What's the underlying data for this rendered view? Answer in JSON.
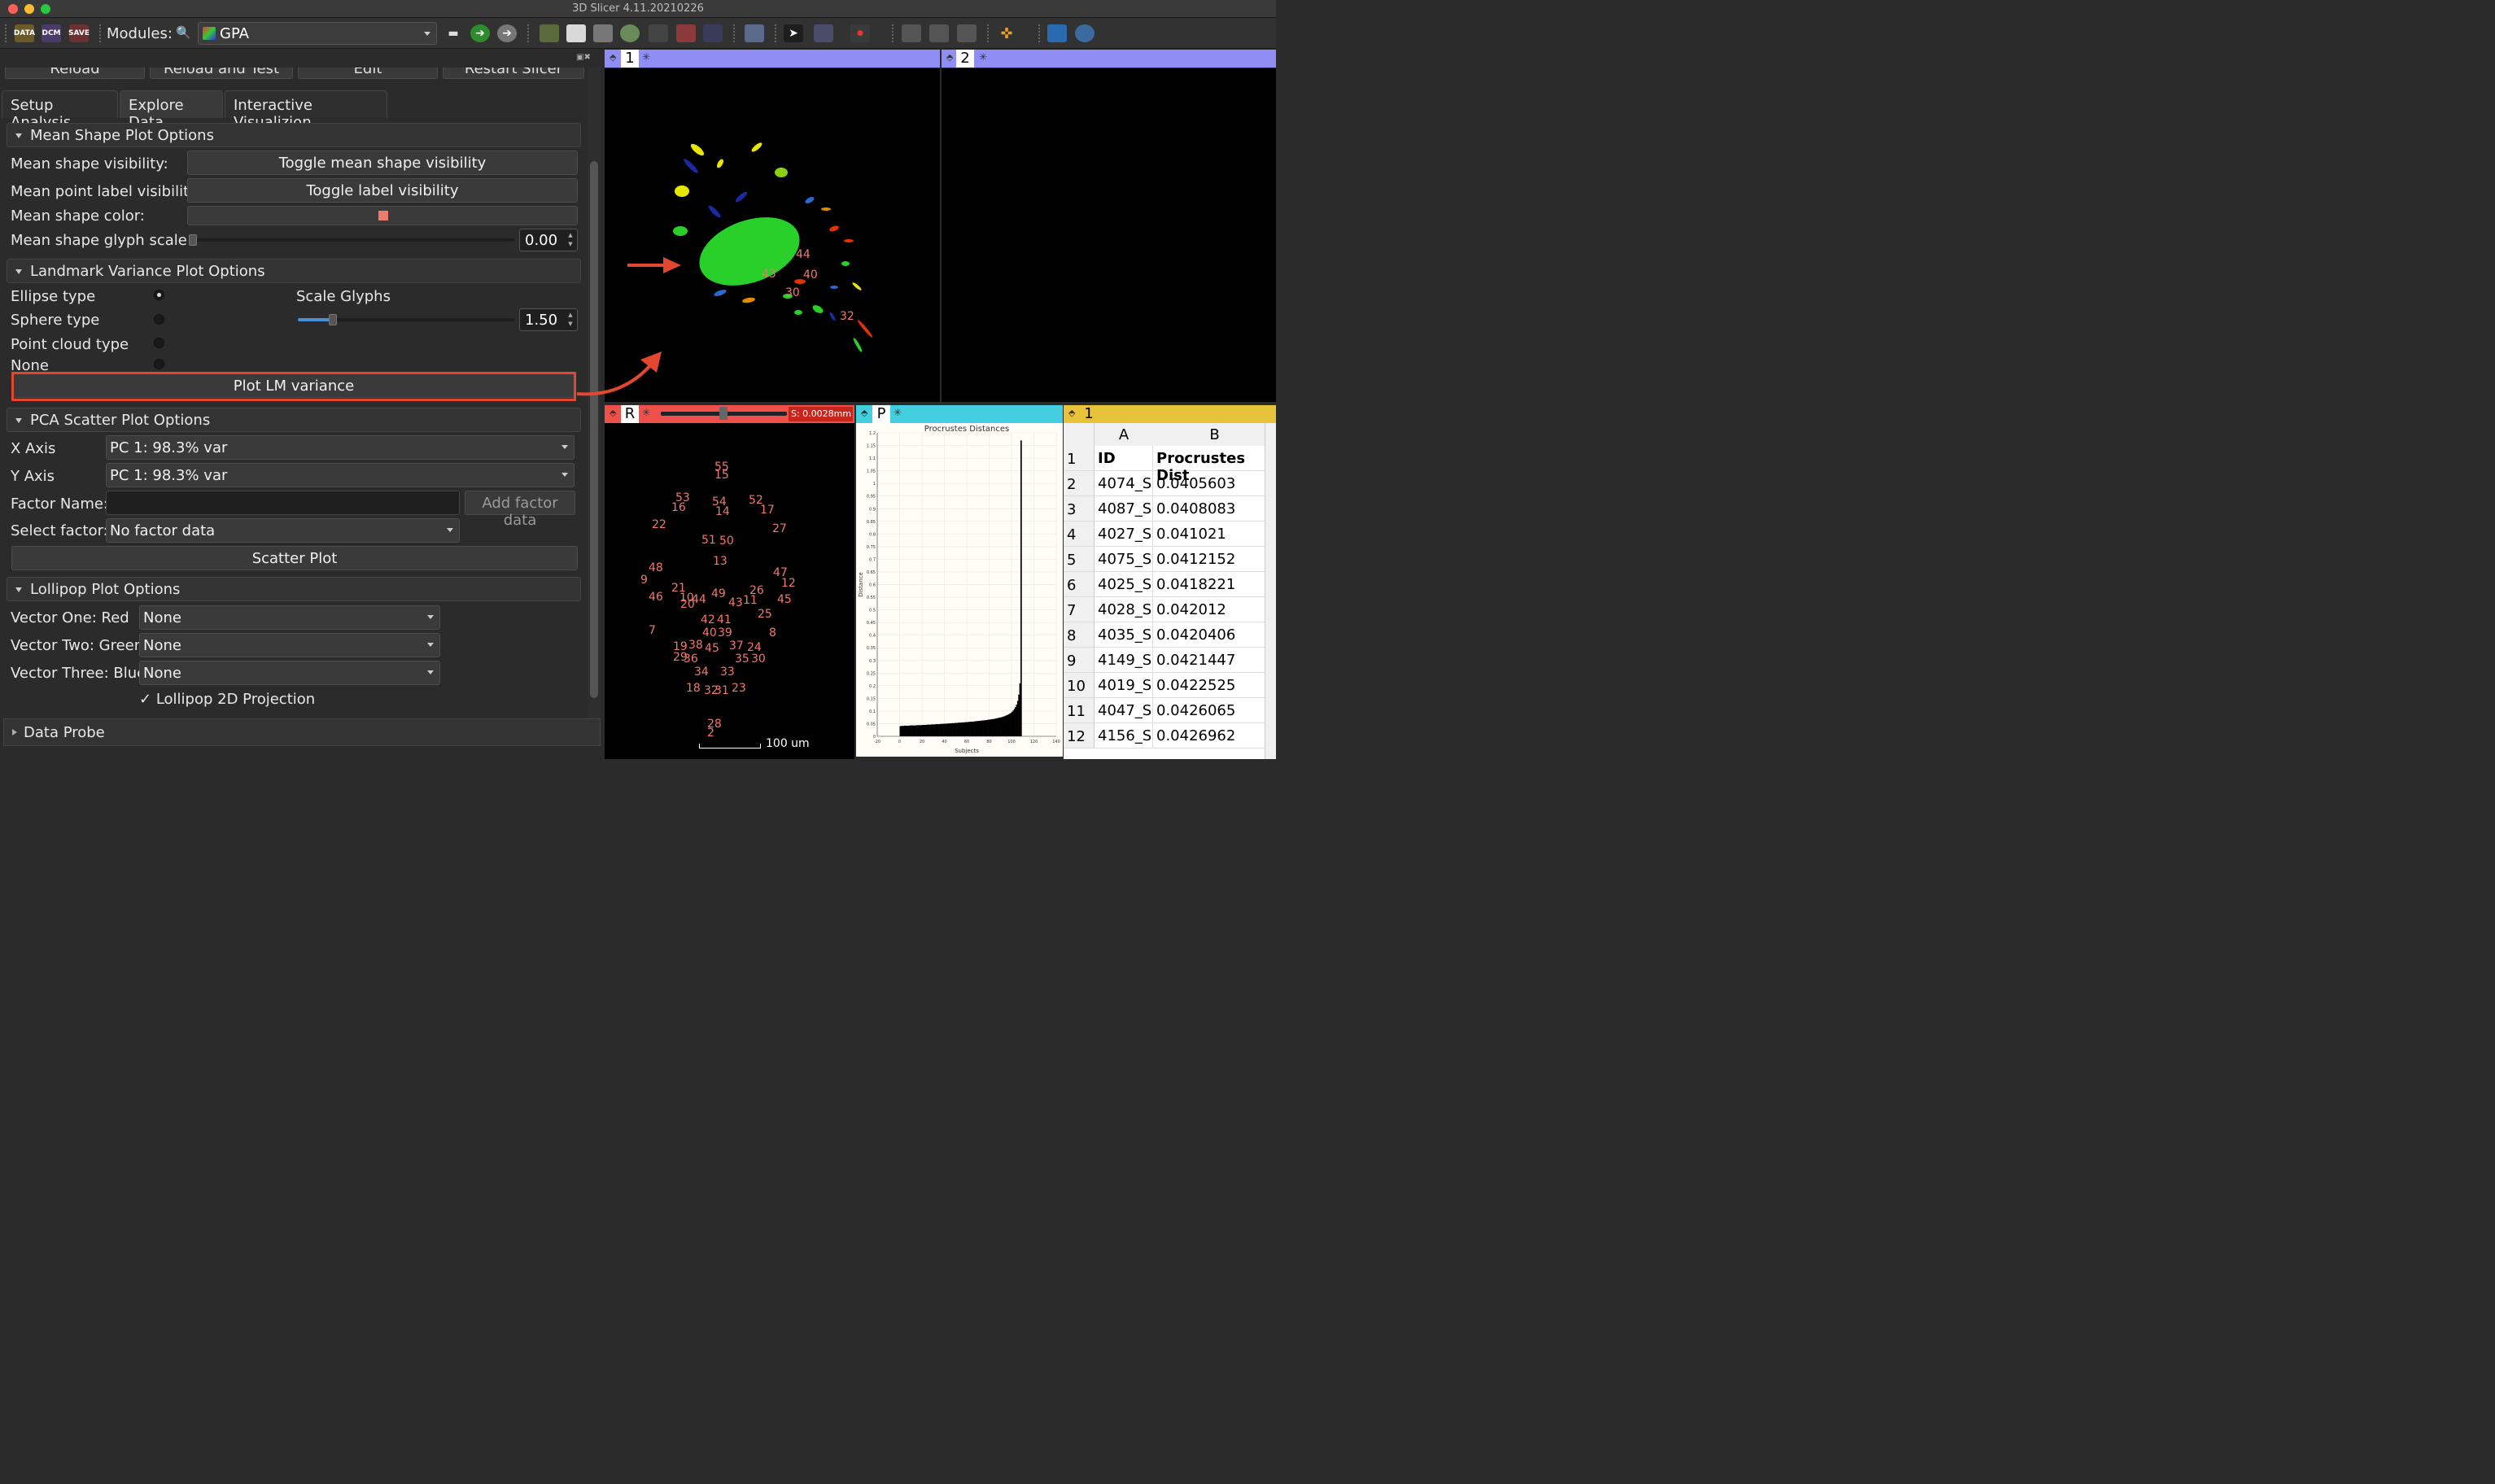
{
  "window": {
    "title": "3D Slicer 4.11.20210226"
  },
  "toolbar": {
    "data_label": "DATA",
    "dcm_label": "DCM",
    "save_label": "SAVE",
    "modules_label": "Modules:",
    "module_value": "GPA"
  },
  "module": {
    "top_buttons": [
      "Reload",
      "Reload and Test",
      "Edit",
      "Restart Slicer"
    ],
    "tabs": [
      "Setup Analysis",
      "Explore Data",
      "Interactive Visualizion"
    ],
    "mean_shape": {
      "header": "Mean Shape Plot Options",
      "visibility_label": "Mean shape visibility:",
      "visibility_button": "Toggle mean shape visibility",
      "label_label": "Mean point label visibility:",
      "label_button": "Toggle label visibility",
      "color_label": "Mean shape color:",
      "color": "#ec7b70",
      "scale_label": "Mean shape glyph scale",
      "scale_value": "0.00"
    },
    "landmark": {
      "header": "Landmark Variance Plot Options",
      "ellipse": "Ellipse type",
      "sphere": "Sphere type",
      "pointcloud": "Point cloud type",
      "none": "None",
      "scale_label": "Scale Glyphs",
      "scale_value": "1.50",
      "plot_button": "Plot LM variance"
    },
    "pca": {
      "header": "PCA Scatter Plot Options",
      "x_label": "X Axis",
      "x_value": "PC 1: 98.3% var",
      "y_label": "Y Axis",
      "y_value": "PC 1: 98.3% var",
      "factor_label": "Factor Name:",
      "add_factor": "Add factor data",
      "select_label": "Select factor:",
      "select_value": "No factor data",
      "scatter_button": "Scatter Plot"
    },
    "lollipop": {
      "header": "Lollipop Plot Options",
      "v1_label": "Vector One: Red",
      "v1": "None",
      "v2_label": "Vector Two: Green",
      "v2": "None",
      "v3_label": "Vector Three: Blue",
      "v3": "None",
      "proj_label": "Lollipop 2D Projection",
      "proj_checked": true
    },
    "dataprobe": "Data Probe"
  },
  "views": {
    "v1": {
      "label": "1",
      "annotations": [
        "44",
        "40",
        "43",
        "30",
        "32"
      ]
    },
    "v2": {
      "label": "2"
    },
    "red": {
      "label": "R",
      "offset": "S: 0.0028mm",
      "scalebar": "100 um",
      "landmarks": [
        "55",
        "15",
        "53",
        "16",
        "54",
        "14",
        "52",
        "17",
        "22",
        "27",
        "51",
        "50",
        "13",
        "48",
        "9",
        "47",
        "12",
        "21",
        "10",
        "20",
        "44",
        "49",
        "26",
        "11",
        "43",
        "45",
        "46",
        "42",
        "41",
        "25",
        "7",
        "40",
        "39",
        "8",
        "19",
        "38",
        "4",
        "5",
        "37",
        "24",
        "29",
        "36",
        "35",
        "30",
        "34",
        "33",
        "18",
        "32",
        "31",
        "23",
        "28",
        "2"
      ]
    },
    "plot": {
      "label": "P"
    },
    "table": {
      "label": "1",
      "col_a": "A",
      "col_b": "B",
      "rows": [
        [
          "1",
          "ID",
          "Procrustes Dist"
        ],
        [
          "2",
          "4074_S",
          "0.0405603"
        ],
        [
          "3",
          "4087_S",
          "0.0408083"
        ],
        [
          "4",
          "4027_S",
          "0.041021"
        ],
        [
          "5",
          "4075_S",
          "0.0412152"
        ],
        [
          "6",
          "4025_S",
          "0.0418221"
        ],
        [
          "7",
          "4028_S",
          "0.042012"
        ],
        [
          "8",
          "4035_S",
          "0.0420406"
        ],
        [
          "9",
          "4149_S",
          "0.0421447"
        ],
        [
          "10",
          "4019_S",
          "0.0422525"
        ],
        [
          "11",
          "4047_S",
          "0.0426065"
        ],
        [
          "12",
          "4156_S",
          "0.0426962"
        ]
      ]
    }
  },
  "chart_data": {
    "type": "bar",
    "title": "Procrustes Distances",
    "xlabel": "Subjects",
    "ylabel": "Distance",
    "xlim": [
      -20,
      140
    ],
    "ylim": [
      0,
      1.2
    ],
    "x_ticks": [
      "-20",
      "0",
      "20",
      "40",
      "60",
      "80",
      "100",
      "120",
      "140"
    ],
    "y_ticks": [
      "0",
      "0.05",
      "0.1",
      "0.15",
      "0.2",
      "0.25",
      "0.3",
      "0.35",
      "0.4",
      "0.45",
      "0.5",
      "0.55",
      "0.6",
      "0.65",
      "0.7",
      "0.75",
      "0.8",
      "0.85",
      "0.9",
      "0.95",
      "1",
      "1.05",
      "1.1",
      "1.15",
      "1.2"
    ],
    "values": [
      0.04,
      0.041,
      0.041,
      0.041,
      0.042,
      0.042,
      0.042,
      0.042,
      0.042,
      0.043,
      0.043,
      0.043,
      0.043,
      0.043,
      0.043,
      0.044,
      0.044,
      0.044,
      0.044,
      0.044,
      0.045,
      0.045,
      0.045,
      0.045,
      0.046,
      0.046,
      0.046,
      0.046,
      0.047,
      0.047,
      0.047,
      0.047,
      0.048,
      0.048,
      0.048,
      0.048,
      0.049,
      0.049,
      0.049,
      0.05,
      0.05,
      0.05,
      0.05,
      0.051,
      0.051,
      0.051,
      0.052,
      0.052,
      0.052,
      0.053,
      0.053,
      0.053,
      0.054,
      0.054,
      0.054,
      0.055,
      0.055,
      0.055,
      0.056,
      0.056,
      0.056,
      0.057,
      0.057,
      0.058,
      0.058,
      0.058,
      0.059,
      0.059,
      0.06,
      0.06,
      0.061,
      0.061,
      0.062,
      0.062,
      0.063,
      0.063,
      0.064,
      0.064,
      0.065,
      0.066,
      0.066,
      0.067,
      0.068,
      0.068,
      0.069,
      0.07,
      0.071,
      0.072,
      0.073,
      0.074,
      0.075,
      0.076,
      0.078,
      0.079,
      0.081,
      0.083,
      0.085,
      0.087,
      0.09,
      0.093,
      0.097,
      0.102,
      0.108,
      0.115,
      0.125,
      0.14,
      0.165,
      0.21,
      1.17
    ]
  }
}
